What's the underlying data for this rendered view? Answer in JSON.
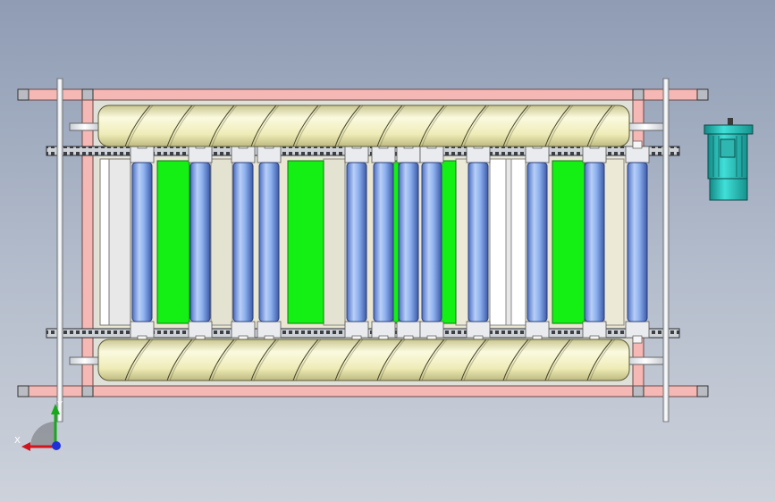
{
  "window": {
    "title": ""
  },
  "triad": {
    "x_label": "X",
    "y_label": "Y"
  },
  "colors": {
    "frame": "#f5b8b4",
    "frame_edge": "#6a4a4a",
    "screw": "#f1efbf",
    "screw_edge": "#5a5a3a",
    "roller": "#8cb0ee",
    "roller_edge": "#2a3f7a",
    "green_panel": "#14f014",
    "panel": "#eae6d2",
    "chain": "#c9cdd3",
    "motor": "#28c7c0",
    "motor_edge": "#0a4a48",
    "shaft": "#f4f6f8",
    "background_top": "#8f9cb4",
    "background_bottom": "#cdd2db"
  },
  "drawing": {
    "roller_count": 12,
    "green_panel_count": 5,
    "screw_count": 2,
    "motor_count": 1
  }
}
